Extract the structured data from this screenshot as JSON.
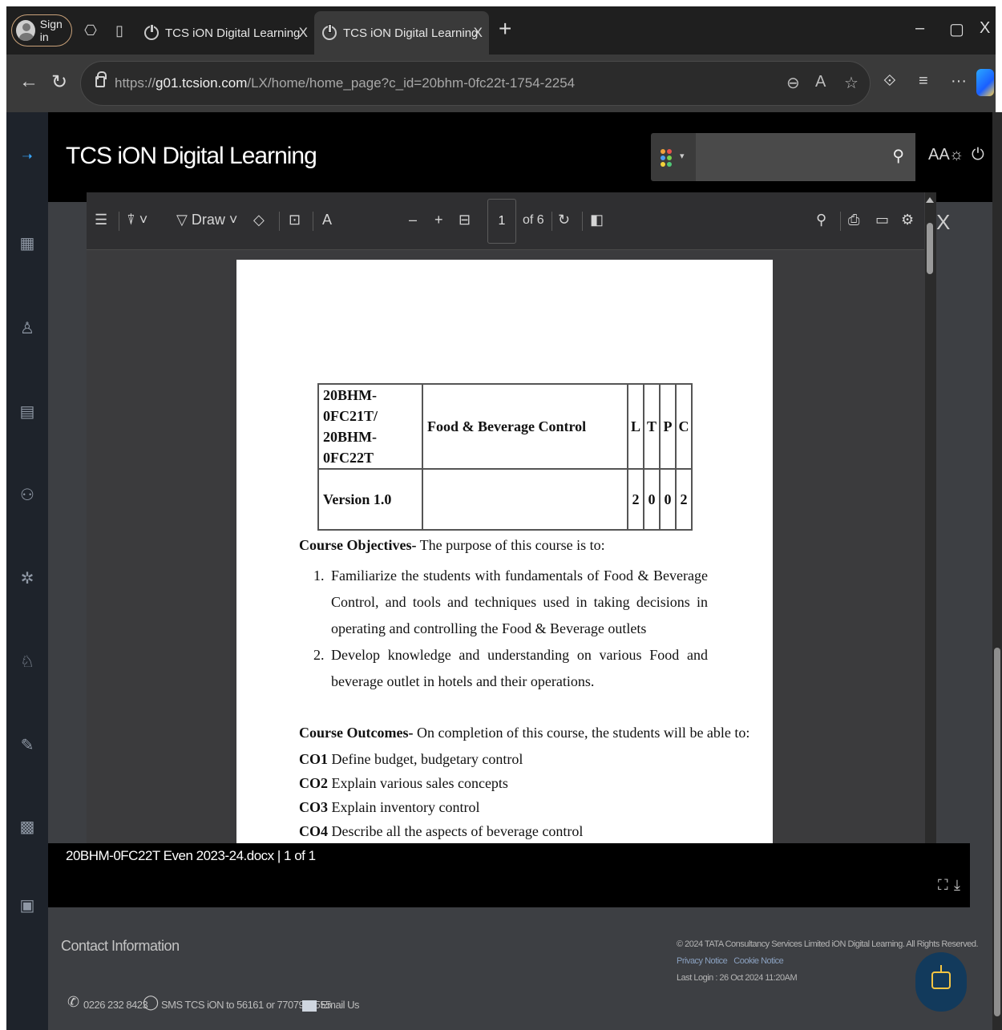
{
  "browser": {
    "signin_label": "Sign in",
    "tabs": [
      {
        "title": "TCS iON Digital Learning",
        "close": "X"
      },
      {
        "title": "TCS iON Digital Learning",
        "close": "X"
      }
    ],
    "new_tab": "+",
    "minimize": "–",
    "restore": "▢",
    "close": "X",
    "url_prefix": "https://",
    "url_domain": "g01.tcsion.com",
    "url_path": "/LX/home/home_page?c_id=20bhm-0fc22t-1754-2254",
    "more": "···"
  },
  "app": {
    "title": "TCS iON Digital Learning",
    "search_placeholder": "",
    "font_size_label": "AA"
  },
  "pdf_toolbar": {
    "draw_label": "Draw",
    "minus": "–",
    "plus": "+",
    "page_current": "1",
    "page_total": "of 6"
  },
  "document": {
    "table": {
      "code": "20BHM-0FC21T/ 20BHM-0FC22T",
      "title": "Food & Beverage Control",
      "headers": [
        "L",
        "T",
        "P",
        "C"
      ],
      "version": "Version 1.0",
      "values": [
        "2",
        "0",
        "0",
        "2"
      ]
    },
    "objectives_title": "Course Objectives-",
    "objectives_intro": " The purpose of this course is to:",
    "objectives": [
      {
        "num": "1.",
        "text": "Familiarize the students with fundamentals of Food & Beverage Control, and tools and techniques used in taking decisions in operating and controlling the Food & Beverage outlets"
      },
      {
        "num": "2.",
        "text": "Develop knowledge and understanding on various Food and beverage outlet in hotels and their operations."
      }
    ],
    "outcomes_title": "Course Outcomes-",
    "outcomes_intro": " On completion of this course, the students will be able to:",
    "outcomes": [
      {
        "code": "CO1",
        "text": " Define budget, budgetary control"
      },
      {
        "code": "CO2",
        "text": " Explain various sales concepts"
      },
      {
        "code": "CO3",
        "text": " Explain inventory control"
      },
      {
        "code": "CO4",
        "text": " Describe all the aspects of beverage control"
      }
    ]
  },
  "bottom_bar": {
    "doc_name": "20BHM-0FC22T Even 2023-24.docx | 1 of 1"
  },
  "footer": {
    "contact_title": "Contact Information",
    "phone": "0226 232 8423",
    "sms": "SMS TCS iON to 56161 or 7707999555",
    "email": "Email Us",
    "copyright": "© 2024 TATA Consultancy Services Limited iON Digital Learning. All Rights Reserved.",
    "privacy": "Privacy Notice",
    "cookie": "Cookie Notice",
    "last_login": "Last Login : 26 Oct 2024 11:20AM"
  },
  "colors": {
    "accent_blue": "#38a6ff",
    "header_black": "#000000",
    "rail": "#1e232b"
  }
}
